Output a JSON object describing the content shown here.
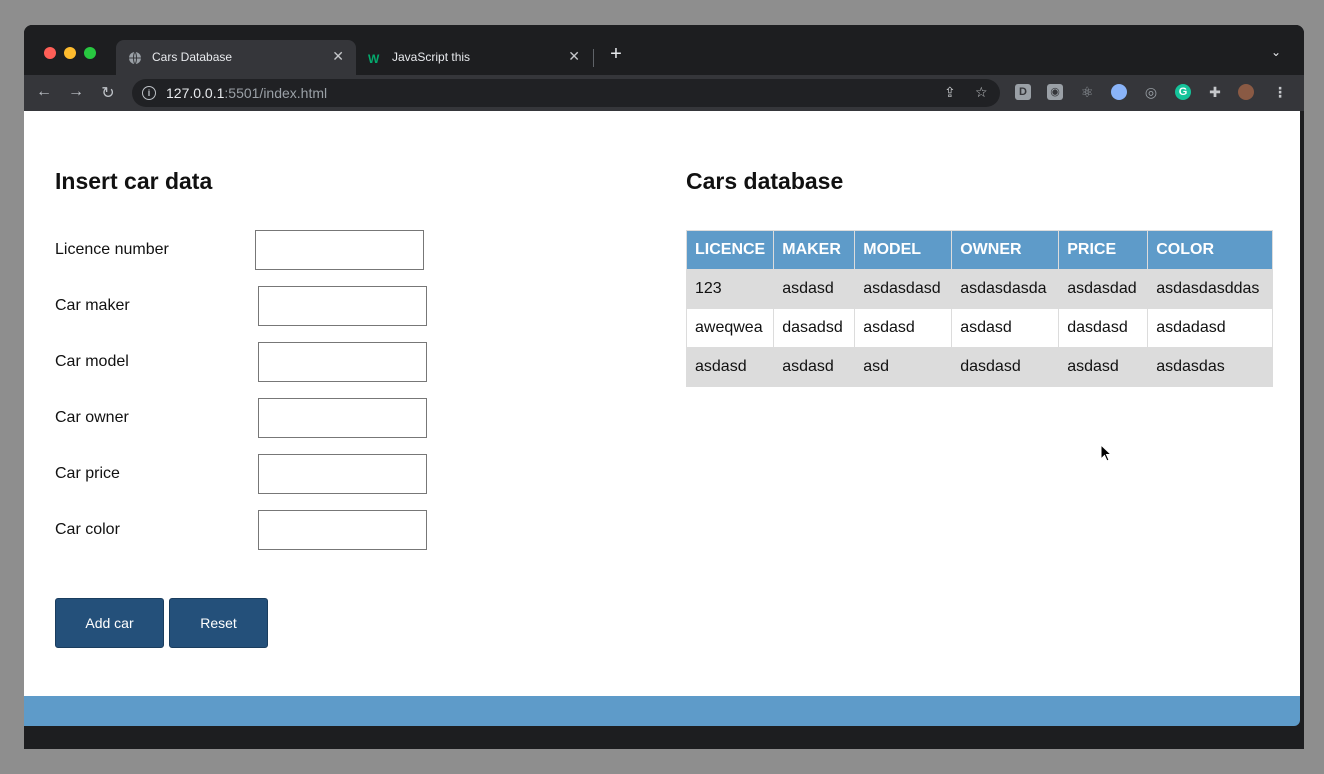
{
  "browser": {
    "tabs": [
      {
        "title": "Cars Database",
        "icon": "globe-icon"
      },
      {
        "title": "JavaScript this",
        "icon": "w3schools-icon"
      }
    ],
    "url_host": "127.0.0.1",
    "url_rest": ":5501/index.html",
    "extensions": [
      "D"
    ]
  },
  "form": {
    "title": "Insert car data",
    "fields": [
      {
        "label": "Licence number",
        "value": ""
      },
      {
        "label": "Car maker",
        "value": ""
      },
      {
        "label": "Car model",
        "value": ""
      },
      {
        "label": "Car owner",
        "value": ""
      },
      {
        "label": "Car price",
        "value": ""
      },
      {
        "label": "Car color",
        "value": ""
      }
    ],
    "add_label": "Add car",
    "reset_label": "Reset"
  },
  "database": {
    "title": "Cars database",
    "headers": [
      "LICENCE",
      "MAKER",
      "MODEL",
      "OWNER",
      "PRICE",
      "COLOR"
    ],
    "rows": [
      [
        "123",
        "asdasd",
        "asdasdasd",
        "asdasdasda",
        "asdasdad",
        "asdasdasddas"
      ],
      [
        "aweqwea",
        "dasadsd",
        "asdasd",
        "asdasd",
        "dasdasd",
        "asdadasd"
      ],
      [
        "asdasd",
        "asdasd",
        "asd",
        "dasdasd",
        "asdasd",
        "asdasdas"
      ]
    ]
  },
  "colors": {
    "accent": "#5e9bc9",
    "button": "#24507a"
  }
}
